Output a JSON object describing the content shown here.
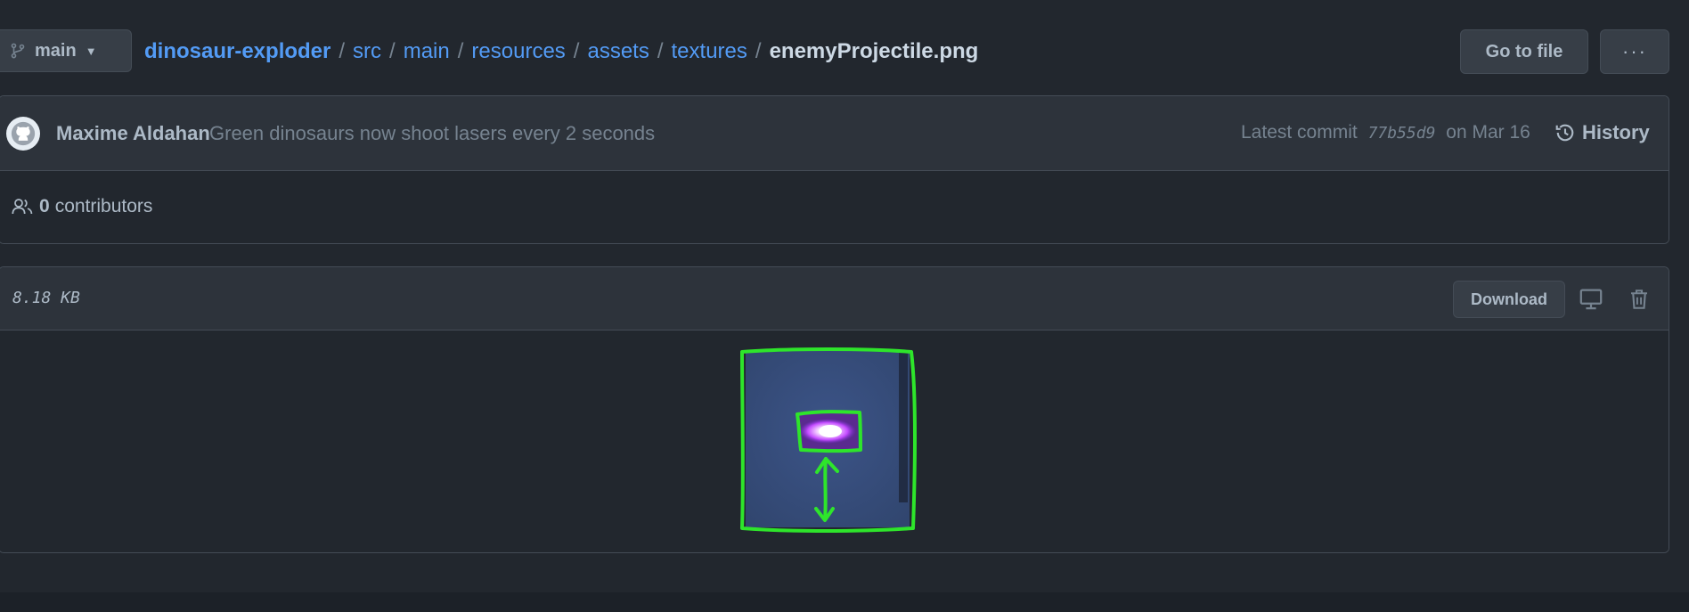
{
  "branch": {
    "name": "main",
    "icon": "git-branch-icon"
  },
  "breadcrumb": {
    "repo": "dinosaur-exploder",
    "parts": [
      "src",
      "main",
      "resources",
      "assets",
      "textures"
    ],
    "separator": "/",
    "file": "enemyProjectile.png"
  },
  "actions": {
    "goto_file": "Go to file",
    "more": "···"
  },
  "commit": {
    "author": "Maxime Aldahan",
    "message": "Green dinosaurs now shoot lasers every 2 seconds",
    "latest_label": "Latest commit",
    "sha": "77b55d9",
    "date": "on Mar 16",
    "history_label": "History"
  },
  "contributors": {
    "count": "0",
    "label": "contributors"
  },
  "file": {
    "size": "8.18 KB",
    "download_label": "Download"
  },
  "colors": {
    "background": "#22272e",
    "link": "#539bf5",
    "annotation": "#2ee52b",
    "image_bg": "#34497a",
    "projectile": "#c44bff"
  }
}
